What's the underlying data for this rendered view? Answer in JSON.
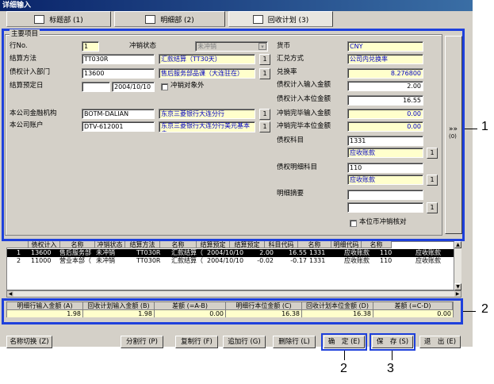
{
  "window": {
    "title": "详细输入"
  },
  "tabs": [
    "标题部 (1)",
    "明细部 (2)",
    "回收计划 (3)"
  ],
  "group_title": "主要项目",
  "left": {
    "row_no_label": "行No.",
    "row_no_value": "1",
    "offset_status_label": "冲销状态",
    "offset_status_value": "未冲销",
    "settle_method_label": "结算方法",
    "settle_method_code": "TT030R",
    "settle_method_name": "汇款结算（TT30天）",
    "dept_label": "债权计入部门",
    "dept_code": "13600",
    "dept_name": "售后服务部品课（大连驻在）",
    "settle_date_label": "结算预定日",
    "settle_date_value": "2004/10/10",
    "offset_exclude_label": "冲销对象外",
    "bank_org_label": "本公司金融机构",
    "bank_org_code": "BOTM-DALIAN",
    "bank_org_name": "东京三菱银行大连分行",
    "account_label": "本公司账户",
    "account_code": "DTV-612001",
    "account_name": "东京三菱银行大连分行美元基本户"
  },
  "right": {
    "currency_label": "货币",
    "currency_value": "CNY",
    "rate_method_label": "汇兑方式",
    "rate_method_value": "公司内兑换率",
    "rate_label": "兑换率",
    "rate_value": "8.276800",
    "claim_input_label": "债权计入输入金额",
    "claim_input_value": "2.00",
    "claim_base_label": "债权计入本位金额",
    "claim_base_value": "16.55",
    "offset_input_label": "冲销完毕输入金额",
    "offset_input_value": "0.00",
    "offset_base_label": "冲销完毕本位金额",
    "offset_base_value": "0.00",
    "subject_label": "债权科目",
    "subject_code": "1331",
    "subject_name": "应收账款",
    "detail_subject_label": "债权明细科目",
    "detail_code": "110",
    "detail_name": "应收账款",
    "memo_label": "明细摘要",
    "base_offset_label": "本位币冲销核对"
  },
  "side_button": {
    "arrows": "»»",
    "label": "(0)"
  },
  "grid": {
    "headers": [
      "债权计入",
      "名称",
      "冲销状态",
      "结算方法",
      "名称",
      "结算预定",
      "结算预定",
      "科目代码",
      "名称",
      "明细代码",
      "名称"
    ],
    "rows": [
      [
        "1",
        "13600",
        "售后服务部",
        "未冲销",
        "TT030R",
        "汇款结算（",
        "2004/10/10",
        "2.00",
        "16.55",
        "1331",
        "应收账款",
        "110",
        "应收账款"
      ],
      [
        "2",
        "11000",
        "营业本部（",
        "未冲销",
        "TT030R",
        "汇款结算（",
        "2004/10/10",
        "-0.02",
        "-0.17",
        "1331",
        "应收账款",
        "110",
        "应收账款"
      ]
    ]
  },
  "summary": {
    "headers": [
      "明细行输入金额 (A)",
      "回收计划输入金额 (B)",
      "差额 (=A-B)",
      "明细行本位金额 (C)",
      "回收计划本位金额 (D)",
      "差额 (=C-D)"
    ],
    "values": [
      "1.98",
      "1.98",
      "0.00",
      "16.38",
      "16.38",
      "0.00"
    ]
  },
  "buttons": {
    "name_switch": "名称切换 (Z)",
    "split_row": "分割行 (P)",
    "copy_row": "复制行 (F)",
    "add_row": "追加行 (G)",
    "delete_row": "删除行 (L)",
    "confirm": "确　定 (E)",
    "save": "保　存 (S)",
    "exit": "退　出 (E)"
  },
  "callouts": [
    "1",
    "2",
    "2",
    "3"
  ]
}
